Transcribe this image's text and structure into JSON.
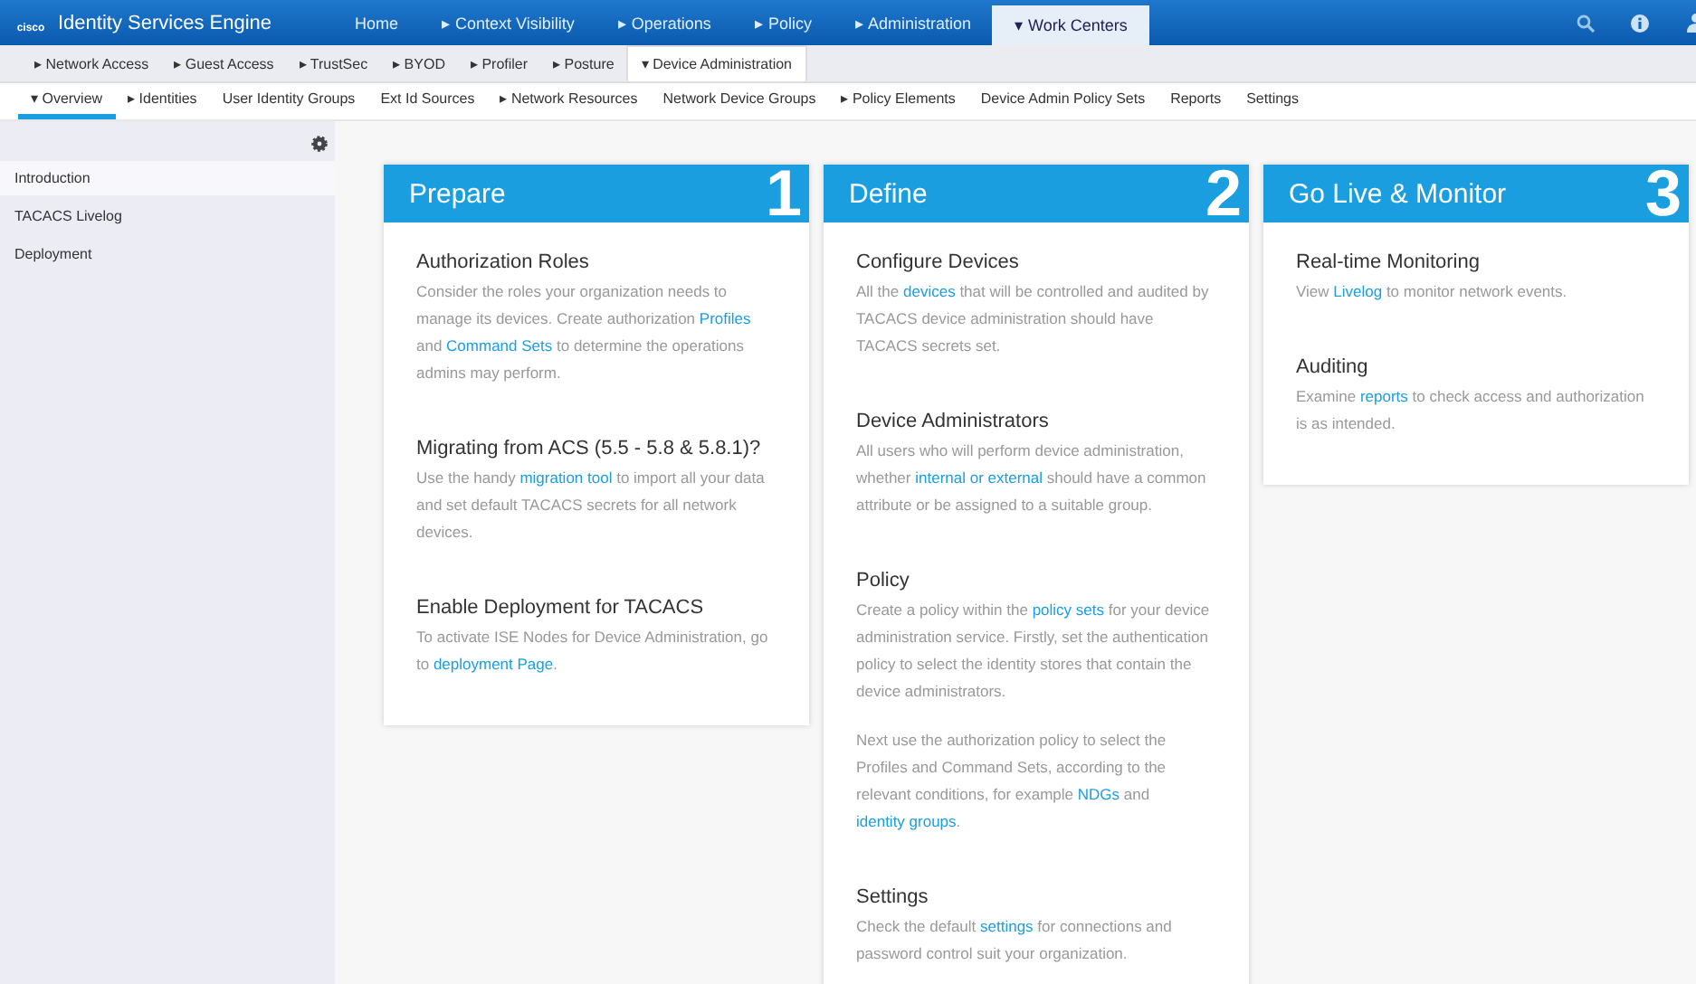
{
  "header": {
    "logo_text": "cisco",
    "product": "Identity Services Engine",
    "tabs": [
      {
        "label": "Home",
        "selected": false
      },
      {
        "label": "▸ Context Visibility",
        "selected": false
      },
      {
        "label": "▸ Operations",
        "selected": false
      },
      {
        "label": "▸ Policy",
        "selected": false
      },
      {
        "label": "▸ Administration",
        "selected": false
      },
      {
        "label": "▾ Work Centers",
        "selected": true
      }
    ]
  },
  "subnav": [
    {
      "label": "▸ Network Access",
      "selected": false
    },
    {
      "label": "▸ Guest Access",
      "selected": false
    },
    {
      "label": "▸ TrustSec",
      "selected": false
    },
    {
      "label": "▸ BYOD",
      "selected": false
    },
    {
      "label": "▸ Profiler",
      "selected": false
    },
    {
      "label": "▸ Posture",
      "selected": false
    },
    {
      "label": "▾ Device Administration",
      "selected": true
    }
  ],
  "menu": [
    {
      "label": "▾ Overview",
      "selected": true
    },
    {
      "label": "▸ Identities",
      "selected": false
    },
    {
      "label": "User Identity Groups",
      "selected": false
    },
    {
      "label": "Ext Id Sources",
      "selected": false
    },
    {
      "label": "▸ Network Resources",
      "selected": false
    },
    {
      "label": "Network Device Groups",
      "selected": false
    },
    {
      "label": "▸ Policy Elements",
      "selected": false
    },
    {
      "label": "Device Admin Policy Sets",
      "selected": false
    },
    {
      "label": "Reports",
      "selected": false
    },
    {
      "label": "Settings",
      "selected": false
    }
  ],
  "sidebar": {
    "items": [
      {
        "label": "Introduction",
        "selected": true
      },
      {
        "label": "TACACS Livelog",
        "selected": false
      },
      {
        "label": "Deployment",
        "selected": false
      }
    ]
  },
  "cards": [
    {
      "title": "Prepare",
      "number": "1",
      "sections": [
        {
          "heading": "Authorization Roles",
          "paragraphs": [
            [
              {
                "text": "Consider the roles your organization needs to manage its devices. Create authorization ",
                "link": false
              },
              {
                "text": "Profiles",
                "link": true
              },
              {
                "text": " and ",
                "link": false
              },
              {
                "text": "Command Sets",
                "link": true
              },
              {
                "text": " to determine the operations admins may perform.",
                "link": false
              }
            ]
          ]
        },
        {
          "heading": "Migrating from ACS (5.5 - 5.8 & 5.8.1)?",
          "paragraphs": [
            [
              {
                "text": "Use the handy ",
                "link": false
              },
              {
                "text": "migration tool",
                "link": true
              },
              {
                "text": " to import all your data and set default TACACS secrets for all network devices.",
                "link": false
              }
            ]
          ]
        },
        {
          "heading": "Enable Deployment for TACACS",
          "paragraphs": [
            [
              {
                "text": "To activate ISE Nodes for Device Administration, go to ",
                "link": false
              },
              {
                "text": "deployment Page",
                "link": true
              },
              {
                "text": ".",
                "link": false
              }
            ]
          ]
        }
      ]
    },
    {
      "title": "Define",
      "number": "2",
      "sections": [
        {
          "heading": "Configure Devices",
          "paragraphs": [
            [
              {
                "text": "All the ",
                "link": false
              },
              {
                "text": "devices",
                "link": true
              },
              {
                "text": " that will be controlled and audited by TACACS device administration should have TACACS secrets set.",
                "link": false
              }
            ]
          ]
        },
        {
          "heading": "Device Administrators",
          "paragraphs": [
            [
              {
                "text": "All users who will perform device administration, whether ",
                "link": false
              },
              {
                "text": "internal or external",
                "link": true
              },
              {
                "text": " should have a common attribute or be assigned to a suitable group.",
                "link": false
              }
            ]
          ]
        },
        {
          "heading": "Policy",
          "paragraphs": [
            [
              {
                "text": "Create a policy within the ",
                "link": false
              },
              {
                "text": "policy sets",
                "link": true
              },
              {
                "text": " for your device administration service. Firstly, set the authentication policy to select the identity stores that contain the device administrators.",
                "link": false
              }
            ],
            [
              {
                "text": "Next use the authorization policy to select the Profiles and Command Sets, according to the relevant conditions, for example ",
                "link": false
              },
              {
                "text": "NDGs",
                "link": true
              },
              {
                "text": " and ",
                "link": false
              },
              {
                "text": "identity groups",
                "link": true
              },
              {
                "text": ".",
                "link": false
              }
            ]
          ]
        },
        {
          "heading": "Settings",
          "paragraphs": [
            [
              {
                "text": "Check the default ",
                "link": false
              },
              {
                "text": "settings",
                "link": true
              },
              {
                "text": " for connections and password control suit your organization.",
                "link": false
              }
            ]
          ]
        }
      ]
    },
    {
      "title": "Go Live & Monitor",
      "number": "3",
      "sections": [
        {
          "heading": "Real-time Monitoring",
          "paragraphs": [
            [
              {
                "text": "View ",
                "link": false
              },
              {
                "text": "Livelog",
                "link": true
              },
              {
                "text": " to monitor network events.",
                "link": false
              }
            ]
          ]
        },
        {
          "heading": "Auditing",
          "paragraphs": [
            [
              {
                "text": "Examine ",
                "link": false
              },
              {
                "text": "reports",
                "link": true
              },
              {
                "text": " to check access and authorization is as intended.",
                "link": false
              }
            ]
          ]
        }
      ]
    }
  ]
}
